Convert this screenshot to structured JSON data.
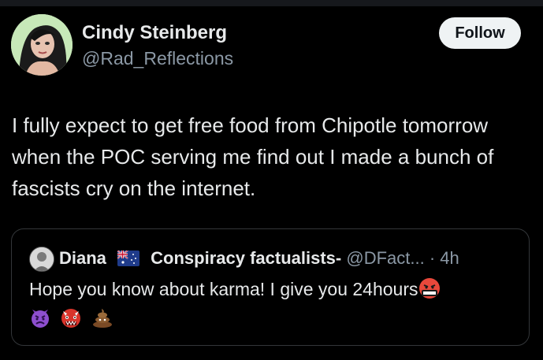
{
  "tweet": {
    "author": {
      "display_name": "Cindy Steinberg",
      "handle": "@Rad_Reflections"
    },
    "follow_label": "Follow",
    "text": "I fully expect to get free food from Chipotle tomorrow when the POC serving me find out I made a bunch of fascists cry on the internet."
  },
  "quote": {
    "name": "Diana",
    "label": "Conspiracy factualists-",
    "handle": "@DFact...",
    "separator": "·",
    "time": "4h",
    "text": "Hope you know about karma! I give you 24hours"
  },
  "icons": {
    "flag": "australia-flag-icon",
    "face": "cursing-face-icon",
    "devil": "angry-devil-icon",
    "ogre": "ogre-icon",
    "poop": "poop-icon"
  }
}
